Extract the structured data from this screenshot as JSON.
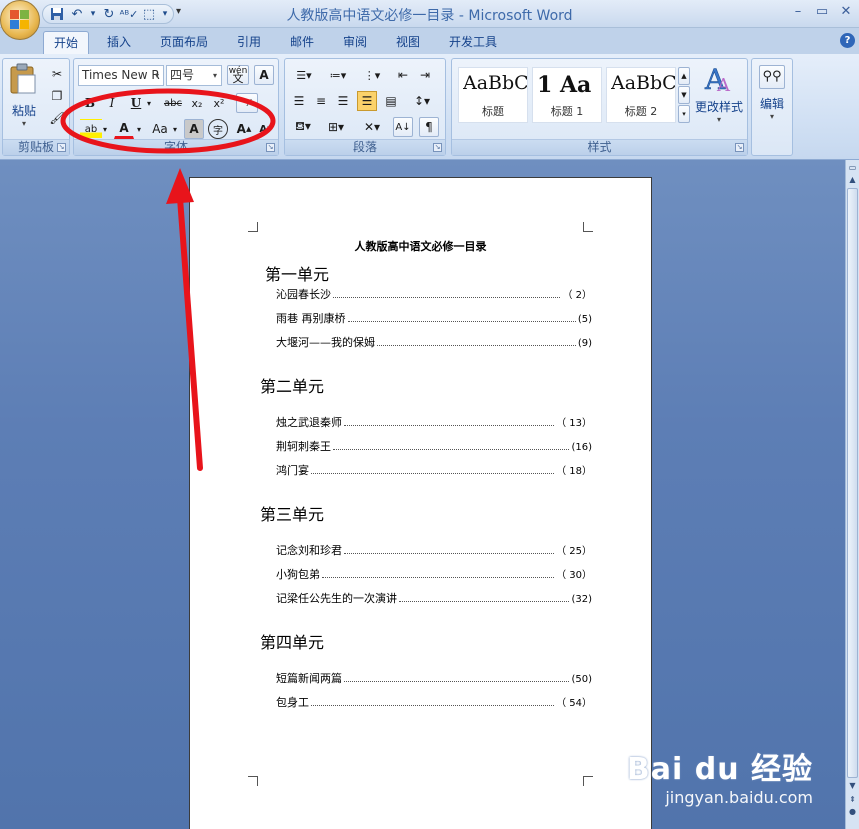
{
  "window": {
    "title": "人教版高中语文必修一目录 - Microsoft Word"
  },
  "tabs": [
    {
      "label": "开始",
      "active": true
    },
    {
      "label": "插入"
    },
    {
      "label": "页面布局"
    },
    {
      "label": "引用"
    },
    {
      "label": "邮件"
    },
    {
      "label": "审阅"
    },
    {
      "label": "视图"
    },
    {
      "label": "开发工具"
    }
  ],
  "ribbon": {
    "clipboard": {
      "label": "剪贴板",
      "paste_label": "粘贴"
    },
    "font": {
      "label": "字体",
      "font_name": "Times New R",
      "font_size": "四号",
      "bold": "B",
      "italic": "I",
      "underline": "U",
      "strike": "abc",
      "subscript": "x₂",
      "superscript": "x²",
      "case": "Aa",
      "highlight": "ab",
      "color": "A",
      "char_shade": "A",
      "enclose": "字",
      "grow": "A",
      "shrink": "A",
      "phonetic": "wén",
      "phonetic_base": "文",
      "clear": "A"
    },
    "paragraph": {
      "label": "段落"
    },
    "styles": {
      "label": "样式",
      "cards": [
        {
          "sample": "AaBbC",
          "name": "标题"
        },
        {
          "sample": "1 Aa",
          "name": "标题 1"
        },
        {
          "sample": "AaBbC",
          "name": "标题 2"
        }
      ],
      "change_styles_label": "更改样式"
    },
    "editing": {
      "label": "编辑"
    }
  },
  "document": {
    "title": "人教版高中语文必修一目录",
    "units": [
      {
        "name": "第一单元",
        "entries": [
          {
            "title": "沁园春长沙",
            "page": "（ 2）"
          },
          {
            "title": "雨巷 再别康桥",
            "page": "(5)"
          },
          {
            "title": "大堰河——我的保姆",
            "page": "(9)"
          }
        ]
      },
      {
        "name": "第二单元",
        "entries": [
          {
            "title": "烛之武退秦师",
            "page": "（ 13）"
          },
          {
            "title": "荆轲刺秦王",
            "page": "(16)"
          },
          {
            "title": "鸿门宴",
            "page": "（ 18）"
          }
        ]
      },
      {
        "name": "第三单元",
        "entries": [
          {
            "title": "记念刘和珍君",
            "page": "（ 25）"
          },
          {
            "title": "小狗包弟",
            "page": "（ 30）"
          },
          {
            "title": "记梁任公先生的一次演讲",
            "page": "(32)"
          }
        ]
      },
      {
        "name": "第四单元",
        "entries": [
          {
            "title": "短篇新闻两篇",
            "page": "(50)"
          },
          {
            "title": "包身工",
            "page": "（ 54）"
          }
        ]
      }
    ]
  },
  "watermark": {
    "brand": "Bai du 经验",
    "url": "jingyan.baidu.com"
  },
  "colors": {
    "annotation": "#e8141b",
    "ribbon_text": "#15428b"
  }
}
